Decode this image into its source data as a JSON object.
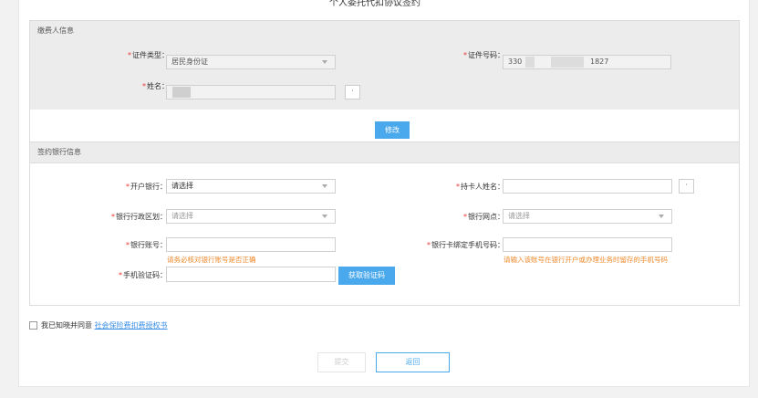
{
  "page_title": "个人委托代扣协议签约",
  "payer": {
    "header": "缴费人信息",
    "id_type_label": "证件类型：",
    "id_type_value": "居民身份证",
    "id_no_label": "证件号码：",
    "id_no_prefix": "330",
    "id_no_suffix": "1827",
    "name_label": "姓名：",
    "dot_button": "·",
    "modify_button": "修改"
  },
  "bank": {
    "header": "签约银行信息",
    "bank_label": "开户银行：",
    "bank_value": "请选择",
    "holder_label": "持卡人姓名：",
    "holder_dot": "·",
    "region_label": "银行行政区划：",
    "region_placeholder": "请选择",
    "branch_label": "银行网点：",
    "branch_placeholder": "请选择",
    "account_label": "银行账号：",
    "account_hint": "请务必核对银行账号是否正确",
    "phone_label": "银行卡绑定手机号码：",
    "phone_hint": "请输入该账号在银行开户或办理业务时留存的手机号码",
    "sms_label": "手机验证码：",
    "sms_button": "获取验证码"
  },
  "agreement": {
    "text": "我已知晓并同意",
    "link": "社会保险费扣费授权书"
  },
  "actions": {
    "submit": "提交",
    "back": "返回"
  },
  "colors": {
    "primary": "#4aa8ed",
    "required": "#ee3333",
    "hint": "#f08a2c"
  }
}
